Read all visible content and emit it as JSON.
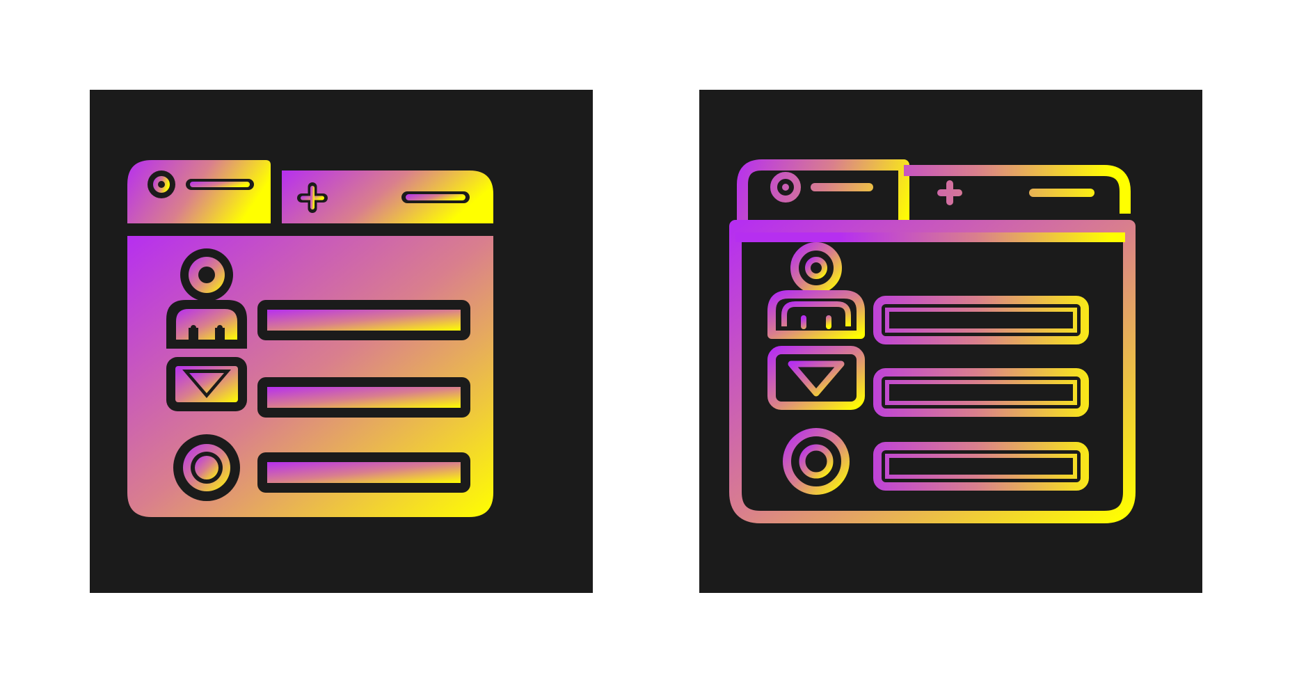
{
  "icons": [
    {
      "name": "online-registration-form-glyph-icon",
      "style": "glyph",
      "elements": [
        "browser-window",
        "browser-tab-active",
        "browser-tab-new",
        "user-icon",
        "mail-icon",
        "circle-icon",
        "input-field",
        "input-field",
        "input-field"
      ]
    },
    {
      "name": "online-registration-form-line-icon",
      "style": "line",
      "elements": [
        "browser-window",
        "browser-tab-active",
        "browser-tab-new",
        "user-icon",
        "mail-icon",
        "circle-icon",
        "input-field",
        "input-field",
        "input-field"
      ]
    }
  ],
  "colors": {
    "page_background": "#ffffff",
    "tile_background": "#1b1b1b",
    "gradient_start": "#b62ff0",
    "gradient_mid": "#d97f8d",
    "gradient_end": "#ffff00"
  }
}
